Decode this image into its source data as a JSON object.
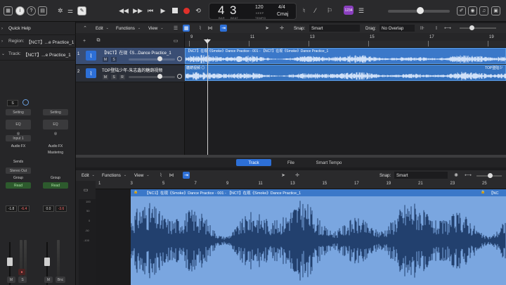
{
  "transport": {
    "lcd_bar": "4",
    "lcd_beat": "3",
    "lcd_bar_label": "BAR",
    "lcd_beat_label": "BEAT",
    "tempo": "120",
    "tempo_label": "KEEP",
    "tempo_sub": "TEMPO",
    "time_sig": "4/4",
    "key": "Cmaj",
    "user_badge": "1234"
  },
  "inspector": {
    "quick_help": "Quick Help",
    "region_label": "Region:",
    "region_value": "【NCT】...e Practice_1",
    "track_label": "Track:",
    "track_value": "【NCT】...e Practice_1",
    "strip1": {
      "setting": "Setting",
      "eq": "EQ",
      "input": "Input 1",
      "fx": "Audio FX",
      "sends": "Sends",
      "output": "Stereo Out",
      "group": "Group",
      "auto": "Read",
      "vol_l": "-1.8",
      "vol_r": "-6.4",
      "m": "M",
      "s": "S",
      "field": "S"
    },
    "strip2": {
      "setting": "Setting",
      "eq": "EQ",
      "fx": "Audio FX",
      "mastering": "Mastering",
      "group": "Group",
      "auto": "Read",
      "vol_l": "0.0",
      "vol_r": "-3.6",
      "m": "M",
      "bnc": "Bnc"
    }
  },
  "tracks_toolbar": {
    "edit": "Edit",
    "functions": "Functions",
    "view": "View",
    "snap_label": "Snap:",
    "snap_value": "Smart",
    "drag_label": "Drag:",
    "drag_value": "No Overlap"
  },
  "tracks": [
    {
      "num": "1",
      "name": "【NCT】在现《S...Dance Practice_1",
      "m": "M",
      "s": "S",
      "r": "R",
      "region": "【NCT】在现《Smoke》Dance Practice - 001 - 【NCT】在现《Smoke》Dance Practice_1"
    },
    {
      "num": "2",
      "name": "TOP登陆少年-朱志鑫的糖葫视频",
      "m": "M",
      "s": "S",
      "r": "R",
      "region": "糖葫视频 ◎",
      "region2": "TOP登陆少"
    }
  ],
  "ruler_ticks": [
    "9",
    "11",
    "13",
    "15",
    "17",
    "19"
  ],
  "editor": {
    "tab_track": "Track",
    "tab_file": "File",
    "tab_smart_tempo": "Smart Tempo",
    "edit": "Edit",
    "functions": "Functions",
    "view": "View",
    "snap_label": "Snap:",
    "snap_value": "Smart",
    "region_name": "【NC1】在现《Smoke》Dance Practice - 001 - 【NCT】在现《Smoke》Dance Practice_1",
    "region_name2": "【NC",
    "ruler_ticks": [
      "1",
      "3",
      "5",
      "7",
      "9",
      "11",
      "13",
      "15",
      "17",
      "19",
      "21",
      "23",
      "25"
    ],
    "scale": [
      "100",
      "50",
      "0",
      "-50",
      "-100"
    ]
  },
  "colors": {
    "accent": "#2d6fd6",
    "region": "#3b78c9",
    "waveform": "#7aa6e0",
    "record": "#e0302a"
  }
}
